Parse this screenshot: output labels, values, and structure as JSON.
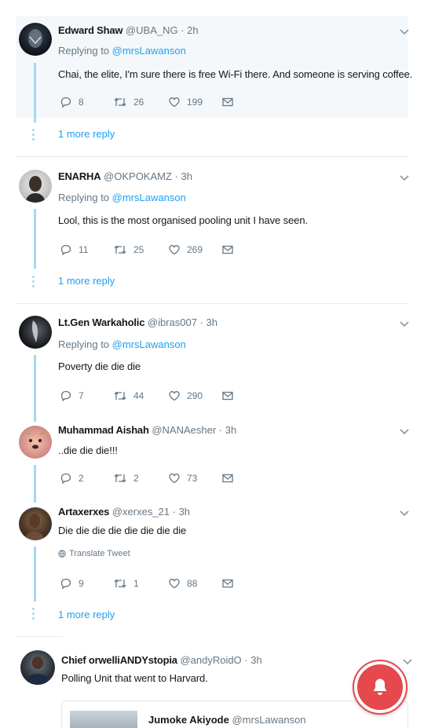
{
  "tweets": [
    {
      "name": "Edward Shaw",
      "handle_time": "@UBA_NG · 2h",
      "replying_label": "Replying to",
      "replying_handle": "@mrsLawanson",
      "text": "Chai,  the elite, I'm sure there is free Wi-Fi there. And someone is serving coffee.",
      "replies": "8",
      "retweets": "26",
      "likes": "199"
    },
    {
      "name": "ENARHA",
      "handle_time": "@OKPOKAMZ · 3h",
      "replying_label": "Replying to",
      "replying_handle": "@mrsLawanson",
      "text": "Lool, this is the most organised pooling unit I have seen.",
      "replies": "11",
      "retweets": "25",
      "likes": "269"
    },
    {
      "name": "Lt.Gen Warkaholic",
      "handle_time": "@ibras007 · 3h",
      "replying_label": "Replying to",
      "replying_handle": "@mrsLawanson",
      "text": "Poverty die die die",
      "replies": "7",
      "retweets": "44",
      "likes": "290"
    },
    {
      "name": "Muhammad Aishah",
      "handle_time": "@NANAesher · 3h",
      "text": "..die die die!!!",
      "replies": "2",
      "retweets": "2",
      "likes": "73"
    },
    {
      "name": "Artaxerxes",
      "handle_time": "@xerxes_21 · 3h",
      "text": "Die die die die die die die die",
      "translate": "Translate Tweet",
      "replies": "9",
      "retweets": "1",
      "likes": "88"
    },
    {
      "name": "Chief orwelliANDYstopia",
      "handle_time": "@andyRoidO · 3h",
      "text": "Polling Unit that went to Harvard."
    }
  ],
  "more_replies": [
    "1 more reply",
    "1 more reply",
    "1 more reply"
  ],
  "quoted": {
    "name": "Jumoke Akiyode",
    "handle": "@mrsLawanson"
  },
  "colors": {
    "accent": "#1da1f2",
    "muted": "#657786",
    "thread": "#a3d8f4",
    "notify": "#e5484d"
  }
}
